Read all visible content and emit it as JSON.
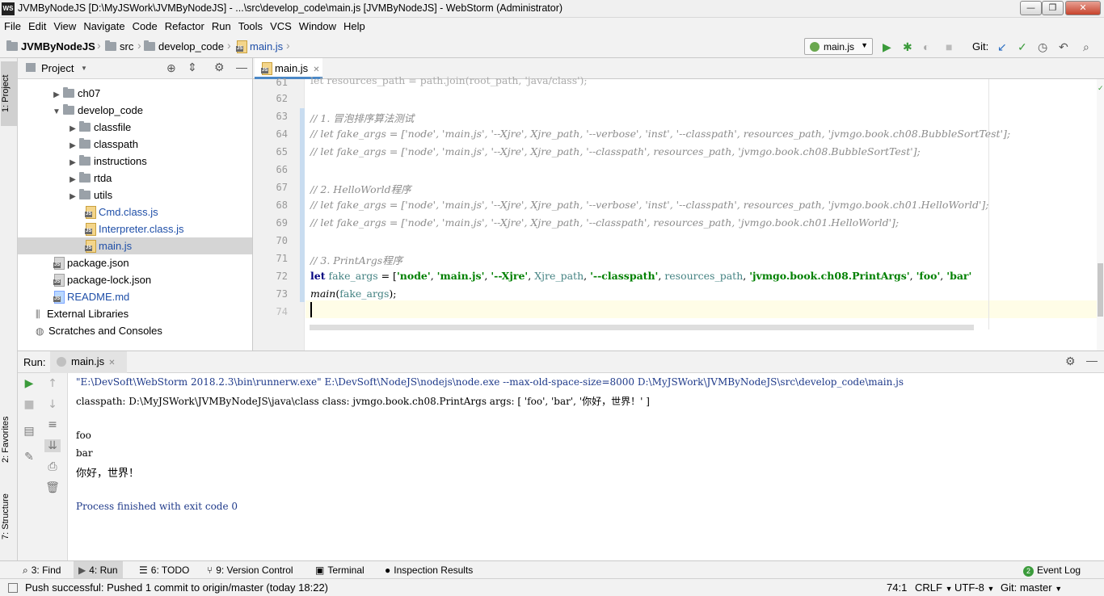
{
  "window": {
    "app_icon": "WS",
    "title": "JVMByNodeJS [D:\\MyJSWork\\JVMByNodeJS] - ...\\src\\develop_code\\main.js [JVMByNodeJS] - WebStorm (Administrator)",
    "buttons": {
      "minimize": "—",
      "maximize": "❐",
      "close": "✕"
    }
  },
  "menu": [
    "File",
    "Edit",
    "View",
    "Navigate",
    "Code",
    "Refactor",
    "Run",
    "Tools",
    "VCS",
    "Window",
    "Help"
  ],
  "navbar": {
    "crumbs": [
      "JVMByNodeJS",
      "src",
      "develop_code",
      "main.js"
    ],
    "run_config": "main.js",
    "git_label": "Git:"
  },
  "left_strip": {
    "project": "1: Project",
    "favorites": "2: Favorites",
    "structure": "7: Structure"
  },
  "project": {
    "header": "Project",
    "tree": [
      {
        "label": "ch07",
        "kind": "folder",
        "arrow": "▶"
      },
      {
        "label": "develop_code",
        "kind": "folder",
        "arrow": "▼"
      },
      {
        "label": "classfile",
        "kind": "folder",
        "arrow": "▶"
      },
      {
        "label": "classpath",
        "kind": "folder",
        "arrow": "▶"
      },
      {
        "label": "instructions",
        "kind": "folder",
        "arrow": "▶"
      },
      {
        "label": "rtda",
        "kind": "folder",
        "arrow": "▶"
      },
      {
        "label": "utils",
        "kind": "folder",
        "arrow": "▶"
      },
      {
        "label": "Cmd.class.js",
        "kind": "js"
      },
      {
        "label": "Interpreter.class.js",
        "kind": "js"
      },
      {
        "label": "main.js",
        "kind": "js",
        "selected": true
      },
      {
        "label": "package.json",
        "kind": "json"
      },
      {
        "label": "package-lock.json",
        "kind": "json"
      },
      {
        "label": "README.md",
        "kind": "md"
      },
      {
        "label": "External Libraries",
        "kind": "lib"
      },
      {
        "label": "Scratches and Consoles",
        "kind": "scratch"
      }
    ]
  },
  "editor": {
    "tab": "main.js",
    "lines": [
      {
        "n": "61",
        "partial": true,
        "text": "let resources_path = path.join(root_path, 'java/class');"
      },
      {
        "n": "62",
        "text": ""
      },
      {
        "n": "63",
        "text": "// 1. 冒泡排序算法测试"
      },
      {
        "n": "64",
        "text": "// let fake_args = ['node', 'main.js', '--Xjre', Xjre_path, '--verbose', 'inst', '--classpath', resources_path, 'jvmgo.book.ch08.BubbleSortTest'];"
      },
      {
        "n": "65",
        "text": "// let fake_args = ['node', 'main.js', '--Xjre', Xjre_path, '--classpath', resources_path, 'jvmgo.book.ch08.BubbleSortTest'];"
      },
      {
        "n": "66",
        "text": ""
      },
      {
        "n": "67",
        "text": "// 2. HelloWorld程序"
      },
      {
        "n": "68",
        "text": "// let fake_args = ['node', 'main.js', '--Xjre', Xjre_path, '--verbose', 'inst', '--classpath', resources_path, 'jvmgo.book.ch01.HelloWorld'];"
      },
      {
        "n": "69",
        "text": "// let fake_args = ['node', 'main.js', '--Xjre', Xjre_path, '--classpath', resources_path, 'jvmgo.book.ch01.HelloWorld'];"
      },
      {
        "n": "70",
        "text": ""
      },
      {
        "n": "71",
        "text": "// 3. PrintArgs程序"
      },
      {
        "n": "72",
        "text": ""
      },
      {
        "n": "73",
        "text": ""
      },
      {
        "n": "74",
        "text": ""
      }
    ],
    "line72": {
      "kw": "let",
      "var": "fake_args",
      "eq": " = [",
      "s1": "'node'",
      "s2": "'main.js'",
      "s3": "'--Xjre'",
      "v1": "Xjre_path",
      "s4": "'--classpath'",
      "v2": "resources_path",
      "s5": "'jvmgo.book.ch08.PrintArgs'",
      "s6": "'foo'",
      "s7": "'bar'",
      "sep": ", "
    },
    "line73": {
      "fn": "main",
      "rest": "(fake_args);",
      "arg": "fake_args"
    }
  },
  "run": {
    "label": "Run:",
    "tab": "main.js",
    "output": [
      {
        "text": "\"E:\\DevSoft\\WebStorm 2018.2.3\\bin\\runnerw.exe\" E:\\DevSoft\\NodeJS\\nodejs\\node.exe --max-old-space-size=8000 D:\\MyJSWork\\JVMByNodeJS\\src\\develop_code\\main.js",
        "color": "#1f3a8a"
      },
      {
        "text": "classpath: D:\\MyJSWork\\JVMByNodeJS\\java\\class class: jvmgo.book.ch08.PrintArgs args: [ 'foo', 'bar', '你好，世界！' ]",
        "color": "#000000"
      },
      {
        "text": "",
        "color": "#000000"
      },
      {
        "text": "foo",
        "color": "#000000"
      },
      {
        "text": "bar",
        "color": "#000000"
      },
      {
        "text": "你好，世界！",
        "color": "#000000"
      },
      {
        "text": "",
        "color": "#000000"
      },
      {
        "text": "Process finished with exit code 0",
        "color": "#1f3a8a"
      }
    ]
  },
  "bottom_tabs": [
    {
      "label": "3: Find",
      "icon": "search-icon"
    },
    {
      "label": "4: Run",
      "icon": "run-icon",
      "active": true
    },
    {
      "label": "6: TODO",
      "icon": "todo-icon"
    },
    {
      "label": "9: Version Control",
      "icon": "vcs-icon"
    },
    {
      "label": "Terminal",
      "icon": "terminal-icon"
    },
    {
      "label": "Inspection Results",
      "icon": "inspection-icon"
    }
  ],
  "event_log": {
    "count": "2",
    "label": "Event Log"
  },
  "status": {
    "message": "Push successful: Pushed 1 commit to origin/master (today 18:22)",
    "position": "74:1",
    "line_sep": "CRLF",
    "encoding": "UTF-8",
    "git": "Git: master"
  },
  "colors": {
    "accent": "#4a88c7",
    "comment": "#8c8c8c",
    "keyword": "#000080",
    "string": "#008000",
    "run_green": "#3b9b3b"
  }
}
